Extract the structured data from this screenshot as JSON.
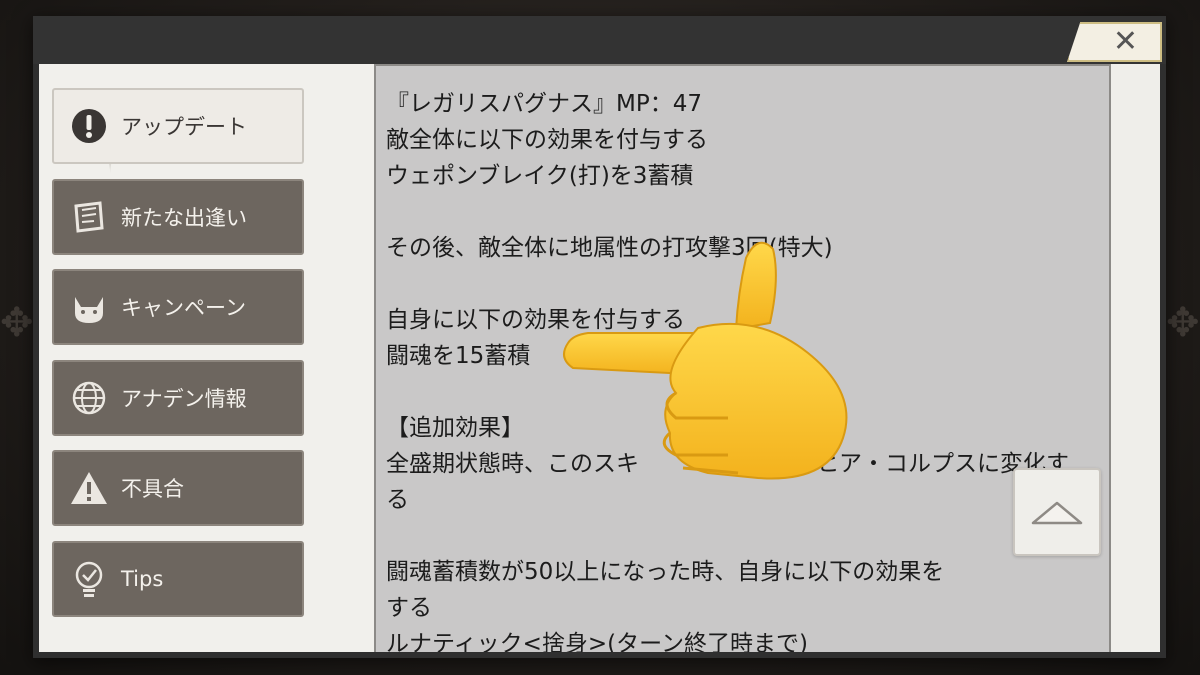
{
  "dialog": {
    "close_icon": "close-icon"
  },
  "sidebar": {
    "items": [
      {
        "label": "アップデート",
        "icon": "exclamation-circle-icon",
        "active": true
      },
      {
        "label": "新たな出逢い",
        "icon": "scroll-map-icon",
        "active": false
      },
      {
        "label": "キャンペーン",
        "icon": "cat-face-icon",
        "active": false
      },
      {
        "label": "アナデン情報",
        "icon": "globe-icon",
        "active": false
      },
      {
        "label": "不具合",
        "icon": "warning-triangle-icon",
        "active": false
      },
      {
        "label": "Tips",
        "icon": "lightbulb-check-icon",
        "active": false
      }
    ]
  },
  "content": {
    "lines": [
      "『レガリスパグナス』MP：47",
      "敵全体に以下の効果を付与する",
      "ウェポンブレイク(打)を3蓄積",
      "",
      "その後、敵全体に地属性の打攻撃3回(特大)",
      "",
      "自身に以下の効果を付与する",
      "闘魂を15蓄積",
      "",
      "【追加効果】",
      "全盛期状態時、このスキ",
      "ヒア・コルプスに変化す",
      "る",
      "",
      "闘魂蓄積数が50以上になった時、自身に以下の効果を",
      "する",
      "ルナティック<捨身>(ターン終了時まで)"
    ]
  },
  "scroll_top_icon": "chevron-up-icon",
  "overlay_emoji": "pointing-hand-emoji"
}
